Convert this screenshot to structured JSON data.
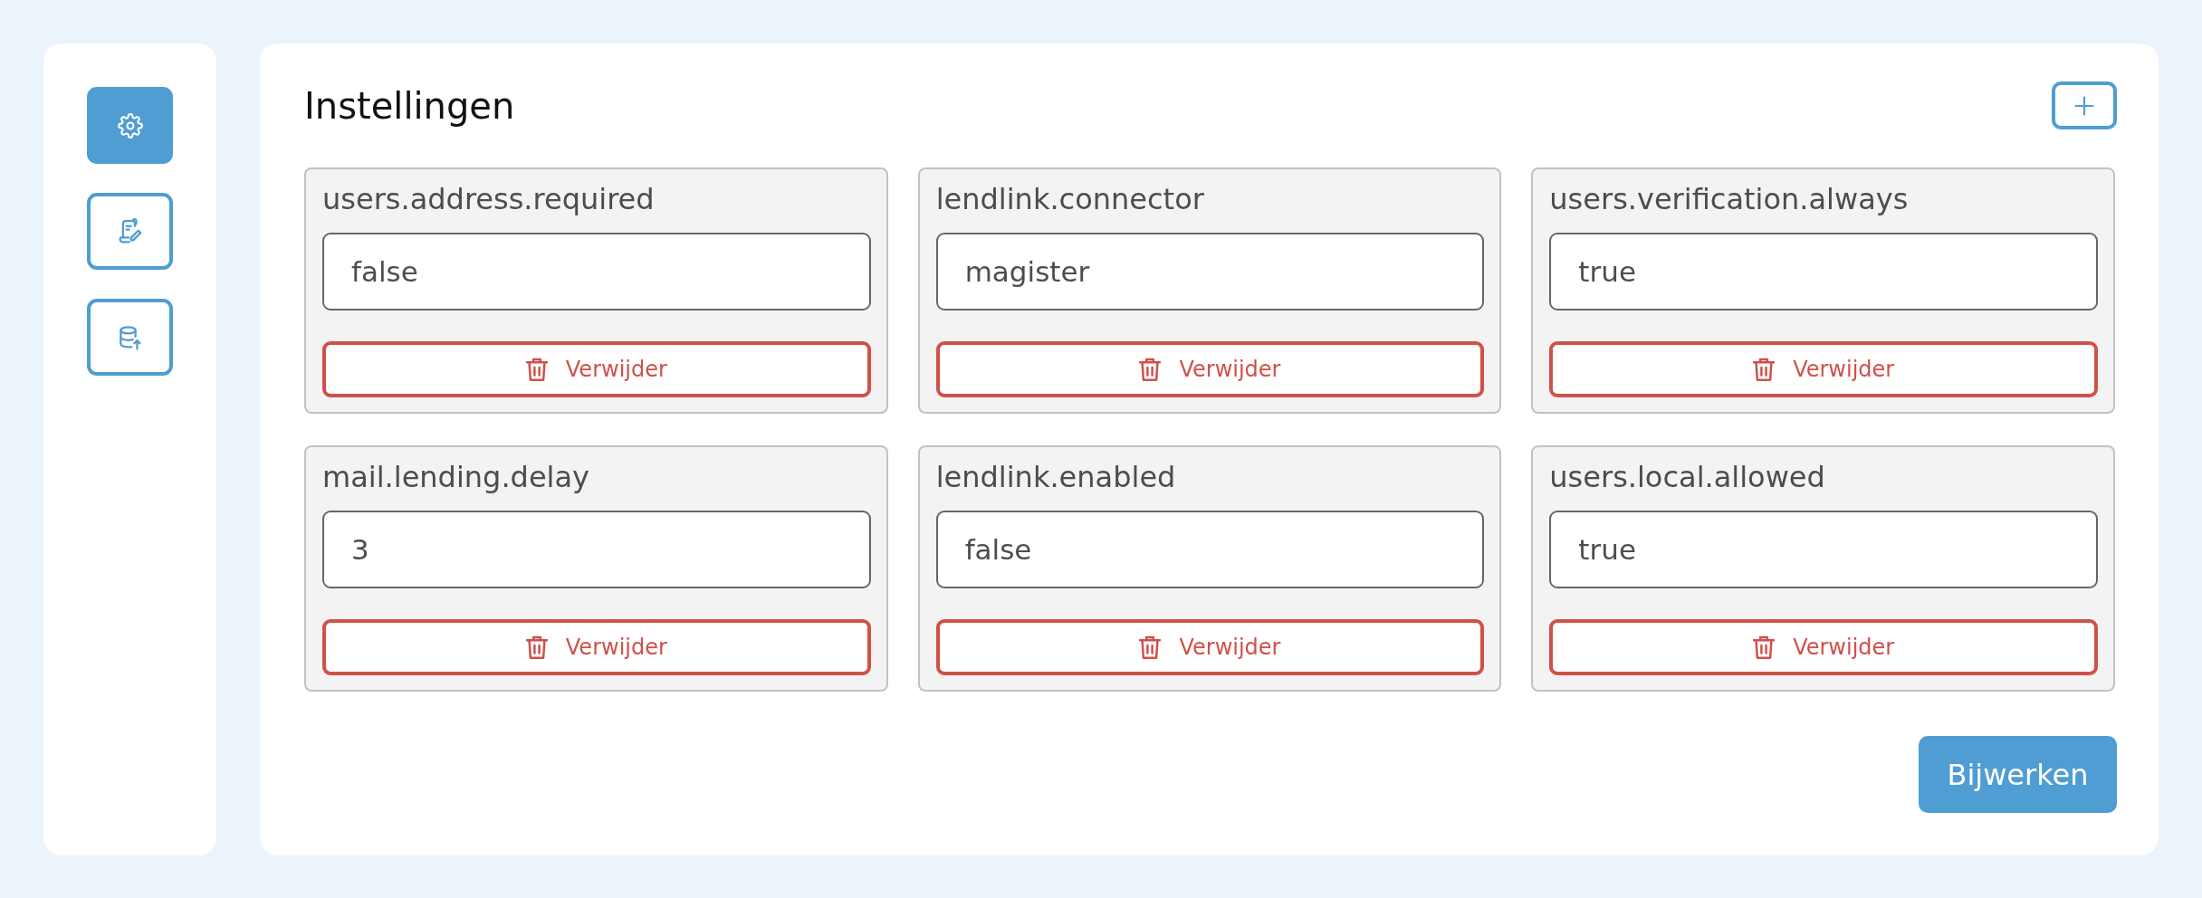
{
  "sidebar": {
    "items": [
      {
        "selected": true
      },
      {
        "selected": false
      },
      {
        "selected": false
      }
    ]
  },
  "settings_panel": {
    "title": "Instellingen",
    "settings": [
      {
        "key": "users.address.required",
        "value": "false",
        "delete_label": "Verwijder"
      },
      {
        "key": "lendlink.connector",
        "value": "magister",
        "delete_label": "Verwijder"
      },
      {
        "key": "users.verification.always",
        "value": "true",
        "delete_label": "Verwijder"
      },
      {
        "key": "mail.lending.delay",
        "value": "3",
        "delete_label": "Verwijder"
      },
      {
        "key": "lendlink.enabled",
        "value": "false",
        "delete_label": "Verwijder"
      },
      {
        "key": "users.local.allowed",
        "value": "true",
        "delete_label": "Verwijder"
      }
    ],
    "submit_label": "Bijwerken"
  }
}
